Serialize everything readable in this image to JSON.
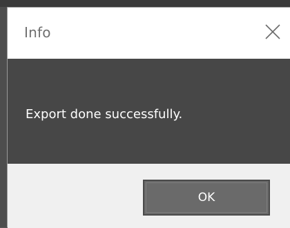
{
  "dialog": {
    "title": "Info",
    "message": "Export done successfully.",
    "ok_label": "OK",
    "close_icon": "close-icon"
  },
  "colors": {
    "titlebar_bg": "#ffffff",
    "message_bg": "#474747",
    "footer_bg": "#f0f0f0",
    "button_bg": "#6a6a6a",
    "message_text": "#ffffff",
    "title_text": "#6f6f6f"
  }
}
